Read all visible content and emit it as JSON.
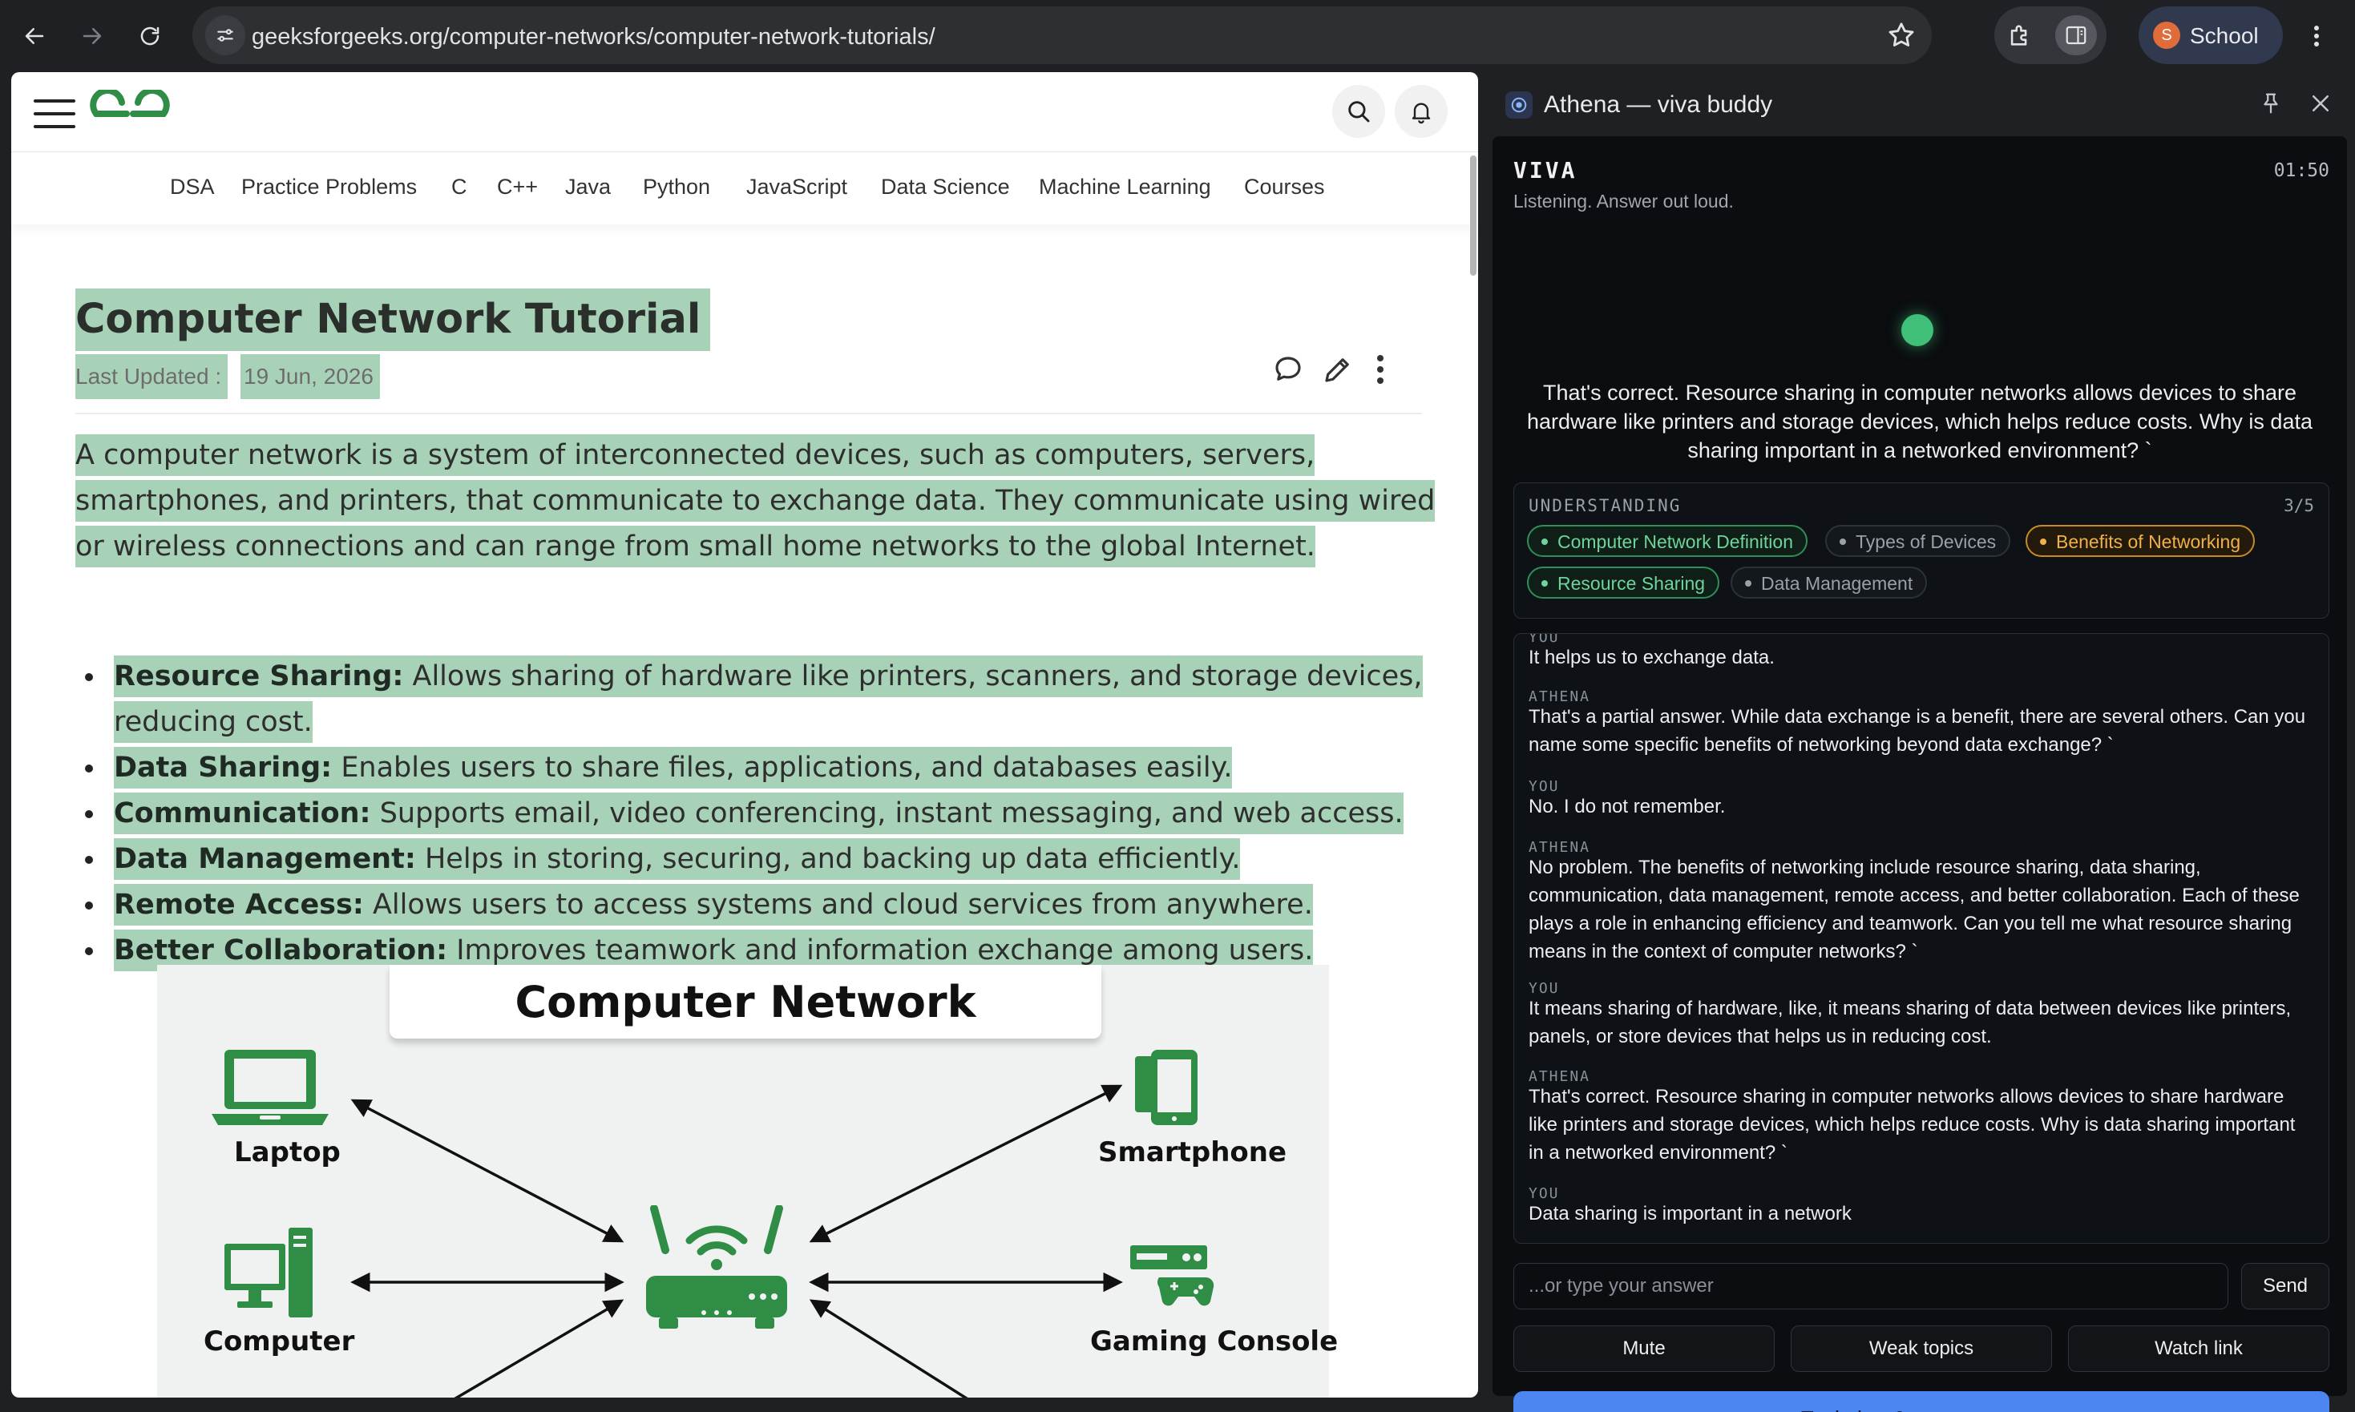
{
  "browser": {
    "url": "geeksforgeeks.org/computer-networks/computer-network-tutorials/",
    "profile_initial": "S",
    "profile_name": "School"
  },
  "site": {
    "nav": [
      "DSA",
      "Practice Problems",
      "C",
      "C++",
      "Java",
      "Python",
      "JavaScript",
      "Data Science",
      "Machine Learning",
      "Courses"
    ],
    "brand_color": "#2f8d46",
    "highlight_color": "#a8d2b8"
  },
  "article": {
    "title": "Computer Network Tutorial",
    "updated_label": "Last Updated :",
    "updated_date": "19 Jun, 2026",
    "intro": "A computer network is a system of interconnected devices, such as computers, servers, smartphones, and printers, that communicate to exchange data. They communicate using wired or wireless connections and can range from small home networks to the global Internet.",
    "bullets": [
      {
        "term": "Resource Sharing:",
        "text": " Allows sharing of hardware like printers, scanners, and storage devices, reducing cost."
      },
      {
        "term": "Data Sharing:",
        "text": " Enables users to share files, applications, and databases easily."
      },
      {
        "term": "Communication:",
        "text": " Supports email, video conferencing, instant messaging, and web access."
      },
      {
        "term": "Data Management:",
        "text": " Helps in storing, securing, and backing up data efficiently."
      },
      {
        "term": "Remote Access:",
        "text": " Allows users to access systems and cloud services from anywhere."
      },
      {
        "term": "Better Collaboration:",
        "text": " Improves teamwork and information exchange among users."
      }
    ],
    "figure": {
      "title": "Computer Network",
      "labels": {
        "laptop": "Laptop",
        "smartphone": "Smartphone",
        "computer": "Computer",
        "gaming": "Gaming Console"
      }
    }
  },
  "panel": {
    "title": "Athena — viva buddy",
    "viva_title": "VIVA",
    "timer": "01:50",
    "status": "Listening. Answer out loud.",
    "question": "That's correct. Resource sharing in computer networks allows devices to share hardware like printers and storage devices, which helps reduce costs. Why is data sharing important in a networked environment? `",
    "understanding": {
      "label": "UNDERSTANDING",
      "count": "3/5",
      "chips": [
        {
          "label": "Computer Network Definition",
          "state": "ok"
        },
        {
          "label": "Types of Devices",
          "state": "none"
        },
        {
          "label": "Benefits of Networking",
          "state": "warn"
        },
        {
          "label": "Resource Sharing",
          "state": "ok"
        },
        {
          "label": "Data Management",
          "state": "none"
        }
      ]
    },
    "transcript": [
      {
        "who": "YOU",
        "text": "It helps us to exchange data."
      },
      {
        "who": "ATHENA",
        "text": "That's a partial answer. While data exchange is a benefit, there are several others. Can you name some specific benefits of networking beyond data exchange? `"
      },
      {
        "who": "YOU",
        "text": "No. I do not remember."
      },
      {
        "who": "ATHENA",
        "text": "No problem. The benefits of networking include resource sharing, data sharing, communication, data management, remote access, and better collaboration. Each of these plays a role in enhancing efficiency and teamwork. Can you tell me what resource sharing means in the context of computer networks? `"
      },
      {
        "who": "YOU",
        "text": "It means sharing of hardware, like, it means sharing of data between devices like printers, panels, or store devices that helps us in reducing cost."
      },
      {
        "who": "ATHENA",
        "text": "That's correct. Resource sharing in computer networks allows devices to share hardware like printers and storage devices, which helps reduce costs. Why is data sharing important in a networked environment? `"
      },
      {
        "who": "YOU",
        "text": "Data sharing is important in a network"
      }
    ],
    "answer_placeholder": "...or type your answer",
    "send_label": "Send",
    "controls": [
      "Mute",
      "Weak topics",
      "Watch link"
    ],
    "end_label": "End viva & get summary",
    "accent": "#4c86f0"
  }
}
